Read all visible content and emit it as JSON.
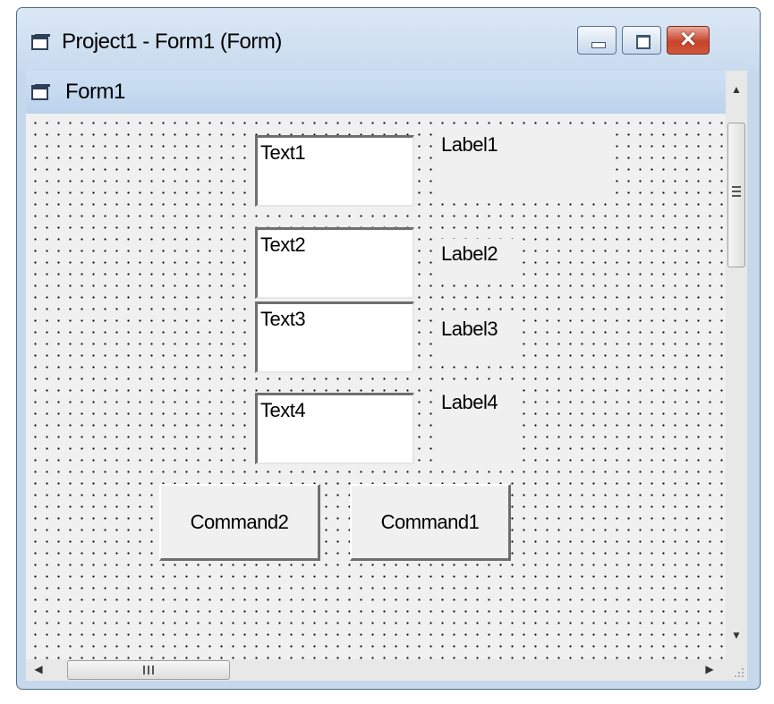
{
  "window": {
    "title": "Project1 - Form1 (Form)"
  },
  "form": {
    "caption": "Form1",
    "textboxes": [
      "Text1",
      "Text2",
      "Text3",
      "Text4"
    ],
    "labels": [
      "Label1",
      "Label2",
      "Label3",
      "Label4"
    ],
    "buttons": [
      "Command2",
      "Command1"
    ]
  },
  "icons": {
    "title": "form-icon",
    "caption": "form-icon",
    "minimize": "minimize-icon",
    "maximize": "maximize-icon",
    "close": "close-icon"
  },
  "colors": {
    "title_bar": "#c9dbef",
    "close_button": "#c8432a",
    "form_background": "#f0f0f0"
  }
}
